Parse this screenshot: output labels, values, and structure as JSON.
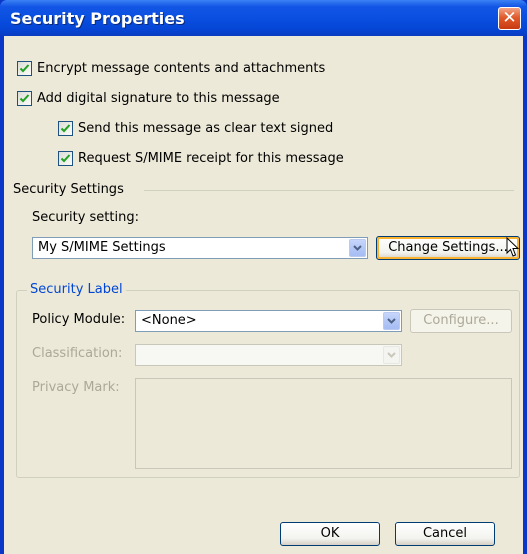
{
  "window": {
    "title": "Security Properties",
    "close_glyph": "✕"
  },
  "checkboxes": [
    {
      "label": "Encrypt message contents and attachments",
      "checked": true
    },
    {
      "label": "Add digital signature to this message",
      "checked": true
    },
    {
      "label": "Send this message as clear text signed",
      "checked": true
    },
    {
      "label": "Request S/MIME receipt for this message",
      "checked": true
    }
  ],
  "security_settings": {
    "group_label": "Security Settings",
    "setting_label": "Security setting:",
    "setting_value": "My S/MIME Settings",
    "change_button": "Change Settings..."
  },
  "security_label": {
    "legend": "Security Label",
    "policy_module_label": "Policy Module:",
    "policy_module_value": "<None>",
    "configure_button": "Configure...",
    "classification_label": "Classification:",
    "classification_value": "",
    "privacy_mark_label": "Privacy Mark:",
    "privacy_mark_value": ""
  },
  "footer": {
    "ok_button": "OK",
    "cancel_button": "Cancel"
  },
  "colors": {
    "titlebar": "#0a4fe0",
    "dialog_bg": "#ece9d8",
    "legend_text": "#0046d5",
    "check": "#21a121"
  }
}
